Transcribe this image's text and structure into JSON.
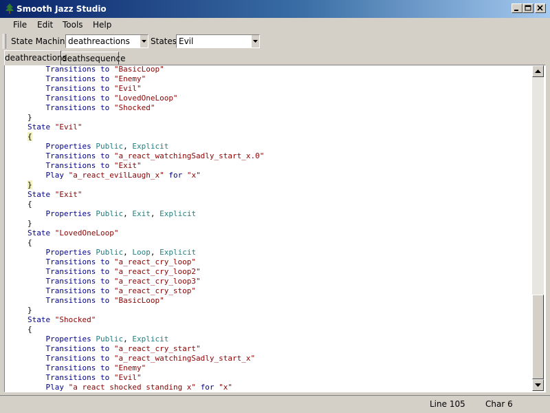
{
  "window": {
    "title": "Smooth Jazz Studio",
    "icon": "tree-icon"
  },
  "menu": [
    {
      "label": "File"
    },
    {
      "label": "Edit"
    },
    {
      "label": "Tools"
    },
    {
      "label": "Help"
    }
  ],
  "toolbar": {
    "state_machines_label": "State Machines",
    "state_machines_value": "deathreactions",
    "states_label": "States",
    "states_value": "Evil"
  },
  "tabs": [
    {
      "label": "deathreactions",
      "active": true
    },
    {
      "label": "deathsequence",
      "active": false
    }
  ],
  "editor": {
    "lines": [
      [
        {
          "t": "    "
        },
        {
          "t": "Transitions to",
          "c": "kw"
        },
        {
          "t": " "
        },
        {
          "t": "\"BasicLoop\"",
          "c": "str"
        }
      ],
      [
        {
          "t": "    "
        },
        {
          "t": "Transitions to",
          "c": "kw"
        },
        {
          "t": " "
        },
        {
          "t": "\"Enemy\"",
          "c": "str"
        }
      ],
      [
        {
          "t": "    "
        },
        {
          "t": "Transitions to",
          "c": "kw"
        },
        {
          "t": " "
        },
        {
          "t": "\"Evil\"",
          "c": "str"
        }
      ],
      [
        {
          "t": "    "
        },
        {
          "t": "Transitions to",
          "c": "kw"
        },
        {
          "t": " "
        },
        {
          "t": "\"LovedOneLoop\"",
          "c": "str"
        }
      ],
      [
        {
          "t": "    "
        },
        {
          "t": "Transitions to",
          "c": "kw"
        },
        {
          "t": " "
        },
        {
          "t": "\"Shocked\"",
          "c": "str"
        }
      ],
      [
        {
          "t": "}"
        }
      ],
      [
        {
          "t": "State",
          "c": "kw"
        },
        {
          "t": " "
        },
        {
          "t": "\"Evil\"",
          "c": "str"
        }
      ],
      [
        {
          "t": "{",
          "c": "brace"
        }
      ],
      [
        {
          "t": "    "
        },
        {
          "t": "Properties",
          "c": "kw"
        },
        {
          "t": " "
        },
        {
          "t": "Public",
          "c": "id"
        },
        {
          "t": ", "
        },
        {
          "t": "Explicit",
          "c": "id"
        }
      ],
      [
        {
          "t": "    "
        },
        {
          "t": "Transitions to",
          "c": "kw"
        },
        {
          "t": " "
        },
        {
          "t": "\"a_react_watchingSadly_start_x.0\"",
          "c": "str"
        }
      ],
      [
        {
          "t": "    "
        },
        {
          "t": "Transitions to",
          "c": "kw"
        },
        {
          "t": " "
        },
        {
          "t": "\"Exit\"",
          "c": "str"
        }
      ],
      [
        {
          "t": "    "
        },
        {
          "t": "Play",
          "c": "kw"
        },
        {
          "t": " "
        },
        {
          "t": "\"a_react_evilLaugh_x\"",
          "c": "str"
        },
        {
          "t": " "
        },
        {
          "t": "for",
          "c": "kw"
        },
        {
          "t": " "
        },
        {
          "t": "\"x\"",
          "c": "str"
        }
      ],
      [
        {
          "t": "}",
          "c": "brace"
        }
      ],
      [
        {
          "t": "State",
          "c": "kw"
        },
        {
          "t": " "
        },
        {
          "t": "\"Exit\"",
          "c": "str"
        }
      ],
      [
        {
          "t": "{"
        }
      ],
      [
        {
          "t": "    "
        },
        {
          "t": "Properties",
          "c": "kw"
        },
        {
          "t": " "
        },
        {
          "t": "Public",
          "c": "id"
        },
        {
          "t": ", "
        },
        {
          "t": "Exit",
          "c": "id"
        },
        {
          "t": ", "
        },
        {
          "t": "Explicit",
          "c": "id"
        }
      ],
      [
        {
          "t": "}"
        }
      ],
      [
        {
          "t": "State",
          "c": "kw"
        },
        {
          "t": " "
        },
        {
          "t": "\"LovedOneLoop\"",
          "c": "str"
        }
      ],
      [
        {
          "t": "{"
        }
      ],
      [
        {
          "t": "    "
        },
        {
          "t": "Properties",
          "c": "kw"
        },
        {
          "t": " "
        },
        {
          "t": "Public",
          "c": "id"
        },
        {
          "t": ", "
        },
        {
          "t": "Loop",
          "c": "id"
        },
        {
          "t": ", "
        },
        {
          "t": "Explicit",
          "c": "id"
        }
      ],
      [
        {
          "t": "    "
        },
        {
          "t": "Transitions to",
          "c": "kw"
        },
        {
          "t": " "
        },
        {
          "t": "\"a_react_cry_loop\"",
          "c": "str"
        }
      ],
      [
        {
          "t": "    "
        },
        {
          "t": "Transitions to",
          "c": "kw"
        },
        {
          "t": " "
        },
        {
          "t": "\"a_react_cry_loop2\"",
          "c": "str"
        }
      ],
      [
        {
          "t": "    "
        },
        {
          "t": "Transitions to",
          "c": "kw"
        },
        {
          "t": " "
        },
        {
          "t": "\"a_react_cry_loop3\"",
          "c": "str"
        }
      ],
      [
        {
          "t": "    "
        },
        {
          "t": "Transitions to",
          "c": "kw"
        },
        {
          "t": " "
        },
        {
          "t": "\"a_react_cry_stop\"",
          "c": "str"
        }
      ],
      [
        {
          "t": "    "
        },
        {
          "t": "Transitions to",
          "c": "kw"
        },
        {
          "t": " "
        },
        {
          "t": "\"BasicLoop\"",
          "c": "str"
        }
      ],
      [
        {
          "t": "}"
        }
      ],
      [
        {
          "t": "State",
          "c": "kw"
        },
        {
          "t": " "
        },
        {
          "t": "\"Shocked\"",
          "c": "str"
        }
      ],
      [
        {
          "t": "{"
        }
      ],
      [
        {
          "t": "    "
        },
        {
          "t": "Properties",
          "c": "kw"
        },
        {
          "t": " "
        },
        {
          "t": "Public",
          "c": "id"
        },
        {
          "t": ", "
        },
        {
          "t": "Explicit",
          "c": "id"
        }
      ],
      [
        {
          "t": "    "
        },
        {
          "t": "Transitions to",
          "c": "kw"
        },
        {
          "t": " "
        },
        {
          "t": "\"a_react_cry_start\"",
          "c": "str"
        }
      ],
      [
        {
          "t": "    "
        },
        {
          "t": "Transitions to",
          "c": "kw"
        },
        {
          "t": " "
        },
        {
          "t": "\"a_react_watchingSadly_start_x\"",
          "c": "str"
        }
      ],
      [
        {
          "t": "    "
        },
        {
          "t": "Transitions to",
          "c": "kw"
        },
        {
          "t": " "
        },
        {
          "t": "\"Enemy\"",
          "c": "str"
        }
      ],
      [
        {
          "t": "    "
        },
        {
          "t": "Transitions to",
          "c": "kw"
        },
        {
          "t": " "
        },
        {
          "t": "\"Evil\"",
          "c": "str"
        }
      ],
      [
        {
          "t": "    "
        },
        {
          "t": "Play",
          "c": "kw"
        },
        {
          "t": " "
        },
        {
          "t": "\"a_react_shocked_standing_x\"",
          "c": "str"
        },
        {
          "t": " "
        },
        {
          "t": "for",
          "c": "kw"
        },
        {
          "t": " "
        },
        {
          "t": "\"x\"",
          "c": "str"
        }
      ]
    ],
    "scroll_position": 0.93
  },
  "status": {
    "line": "Line 105",
    "char": "Char 6"
  },
  "colors": {
    "keyword": "#00008b",
    "string": "#8b0000",
    "identifier": "#1f7f7f",
    "title_bar": "#0a246a"
  }
}
